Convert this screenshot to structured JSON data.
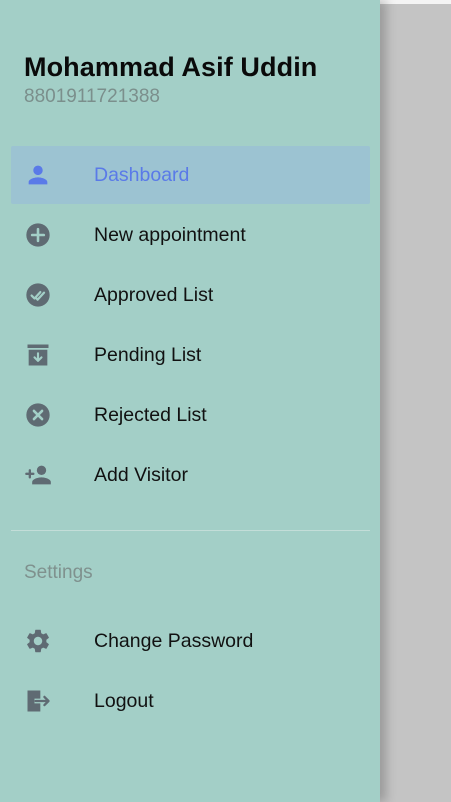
{
  "user": {
    "name": "Mohammad Asif Uddin",
    "phone": "8801911721388"
  },
  "menu": [
    {
      "label": "Dashboard",
      "icon": "person-icon",
      "active": true
    },
    {
      "label": "New appointment",
      "icon": "add-circle-icon",
      "active": false
    },
    {
      "label": "Approved List",
      "icon": "double-check-circle-icon",
      "active": false
    },
    {
      "label": "Pending List",
      "icon": "archive-box-icon",
      "active": false
    },
    {
      "label": "Rejected List",
      "icon": "cancel-circle-icon",
      "active": false
    },
    {
      "label": "Add Visitor",
      "icon": "person-add-icon",
      "active": false
    }
  ],
  "settings": {
    "title": "Settings",
    "items": [
      {
        "label": "Change Password",
        "icon": "gear-icon"
      },
      {
        "label": "Logout",
        "icon": "logout-icon"
      }
    ]
  },
  "colors": {
    "drawer_bg": "#a3cfc7",
    "active_bg": "#9cc3d2",
    "active_text": "#5a7ae8",
    "active_icon": "#5a7ae8",
    "icon_gray": "#5f6b73",
    "backdrop": "#c4c4c4"
  }
}
